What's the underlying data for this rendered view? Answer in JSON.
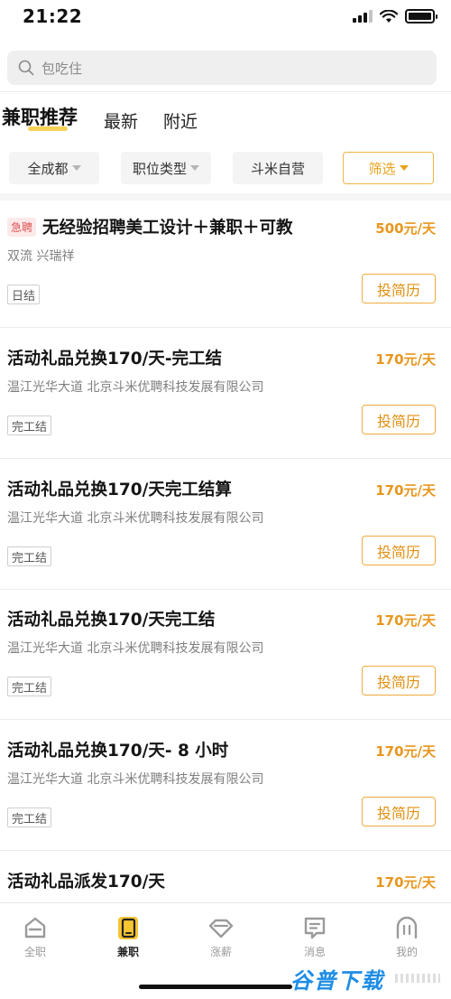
{
  "status_bar": {
    "time": "21:22"
  },
  "search": {
    "placeholder": "包吃住"
  },
  "tabs": [
    {
      "label": "兼职推荐",
      "active": true
    },
    {
      "label": "最新",
      "active": false
    },
    {
      "label": "附近",
      "active": false
    }
  ],
  "filters": [
    {
      "label": "全成都",
      "has_caret": true
    },
    {
      "label": "职位类型",
      "has_caret": true
    },
    {
      "label": "斗米自营",
      "has_caret": false
    },
    {
      "label": "筛选",
      "has_caret": true,
      "highlight": true
    }
  ],
  "jobs": [
    {
      "badge": "急聘",
      "title": "无经验招聘美工设计＋兼职＋可教",
      "pay": "500元/天",
      "location": "双流 兴瑞祥",
      "tag": "日结",
      "apply_label": "投简历"
    },
    {
      "badge": "",
      "title": "活动礼品兑换170/天-完工结",
      "pay": "170元/天",
      "location": "温江光华大道 北京斗米优聘科技发展有限公司",
      "tag": "完工结",
      "apply_label": "投简历"
    },
    {
      "badge": "",
      "title": "活动礼品兑换170/天完工结算",
      "pay": "170元/天",
      "location": "温江光华大道 北京斗米优聘科技发展有限公司",
      "tag": "完工结",
      "apply_label": "投简历"
    },
    {
      "badge": "",
      "title": "活动礼品兑换170/天完工结",
      "pay": "170元/天",
      "location": "温江光华大道 北京斗米优聘科技发展有限公司",
      "tag": "完工结",
      "apply_label": "投简历"
    },
    {
      "badge": "",
      "title": "活动礼品兑换170/天- 8 小时",
      "pay": "170元/天",
      "location": "温江光华大道 北京斗米优聘科技发展有限公司",
      "tag": "完工结",
      "apply_label": "投简历"
    },
    {
      "badge": "",
      "title": "活动礼品派发170/天",
      "pay": "170元/天",
      "location": "",
      "tag": "",
      "apply_label": ""
    }
  ],
  "bottom_nav": [
    {
      "label": "全职",
      "icon": "fulltime-icon",
      "active": false
    },
    {
      "label": "兼职",
      "icon": "parttime-icon",
      "active": true
    },
    {
      "label": "涨薪",
      "icon": "diamond-icon",
      "active": false
    },
    {
      "label": "消息",
      "icon": "message-icon",
      "active": false
    },
    {
      "label": "我的",
      "icon": "profile-icon",
      "active": false
    }
  ],
  "watermark": {
    "text": "谷普下载"
  },
  "colors": {
    "accent": "#f5c93a",
    "pay": "#e8961d",
    "apply_border": "#f0ab3e",
    "urgent": "#e05252"
  }
}
